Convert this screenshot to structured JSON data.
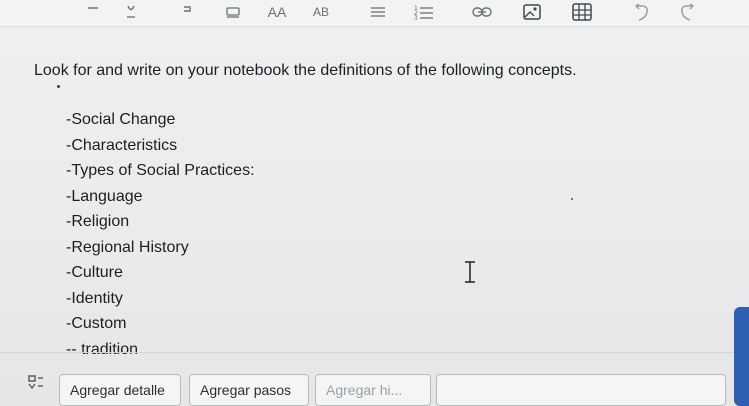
{
  "toolbar": {
    "icons": [
      "minus-icon",
      "underline-icon",
      "strikethrough-icon",
      "text-size-icon",
      "text-highlight-icon",
      "bulleted-list-icon",
      "numbered-list-icon",
      "link-icon",
      "image-icon",
      "table-icon",
      "undo-icon",
      "redo-icon"
    ],
    "text_size_label": "AA",
    "highlight_label": "AB"
  },
  "document": {
    "instruction": "Look for and write on your notebook the definitions of the following concepts.",
    "concepts": [
      "-Social Change",
      "-Characteristics",
      "-Types of Social Practices:",
      "-Language",
      "-Religion",
      "-Regional History",
      "-Culture",
      "-Identity",
      "-Custom",
      "-- tradition"
    ]
  },
  "bottom_bar": {
    "buttons": [
      {
        "label": "Agregar detalle"
      },
      {
        "label": "Agregar pasos"
      },
      {
        "label": "Agregar hi..."
      }
    ]
  },
  "colors": {
    "accent": "#2f5fb3",
    "background": "#eceeef",
    "text": "#1c1f22"
  }
}
